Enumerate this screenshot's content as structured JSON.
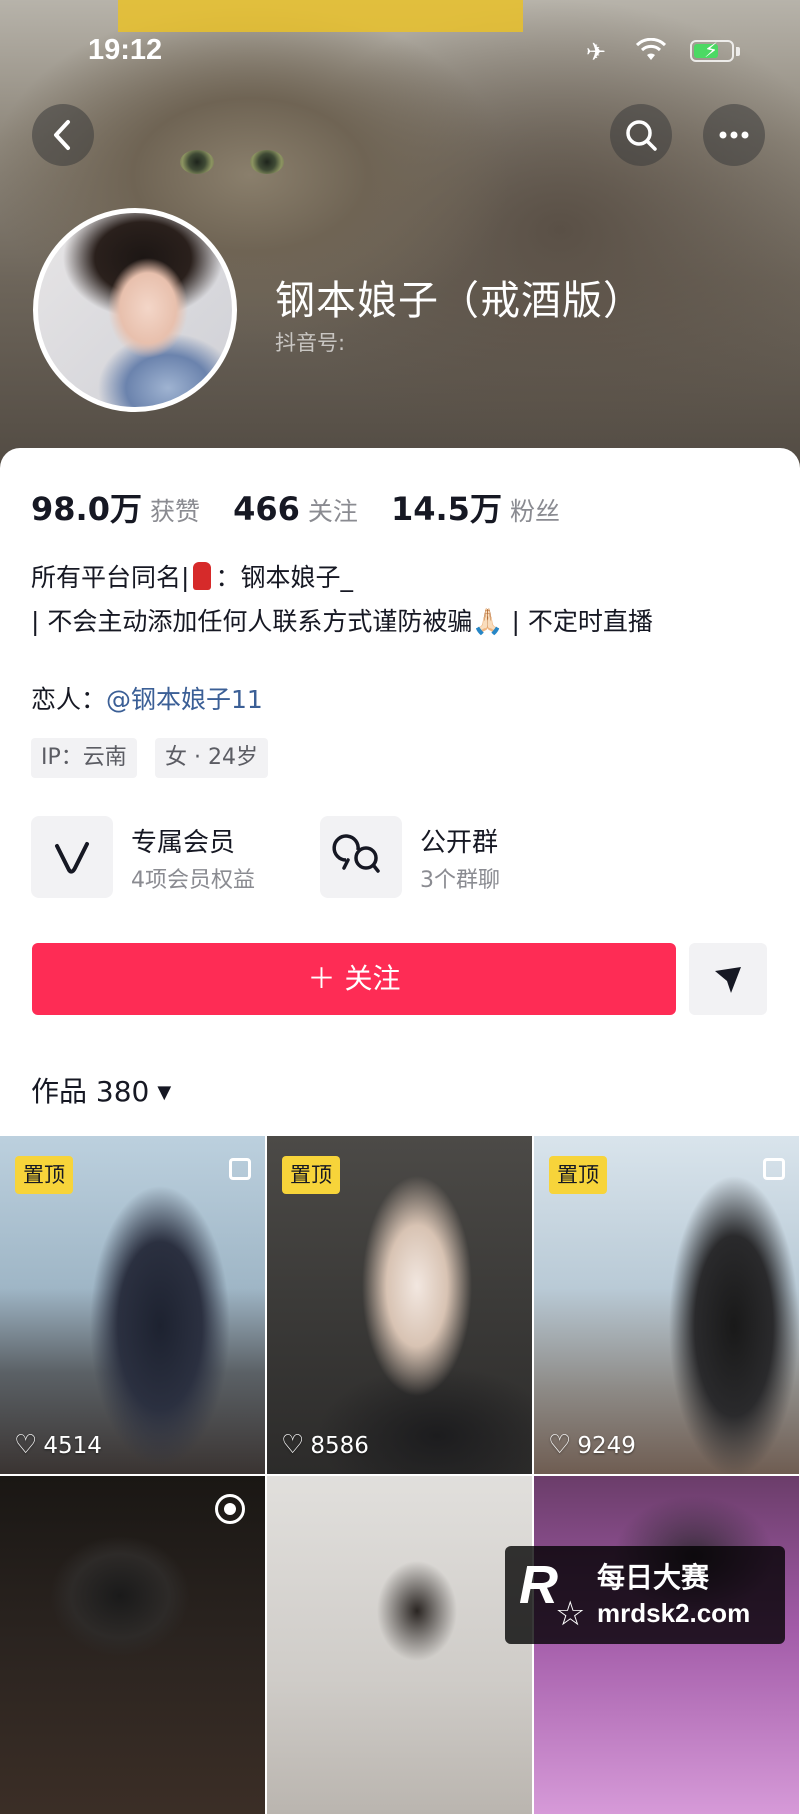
{
  "status_bar": {
    "time": "19:12"
  },
  "profile": {
    "nickname": "钢本娘子（戒酒版）",
    "douyin_id_label": "抖音号:",
    "stats": [
      {
        "num": "98.0万",
        "label": "获赞"
      },
      {
        "num": "466",
        "label": "关注"
      },
      {
        "num": "14.5万",
        "label": "粉丝"
      }
    ],
    "bio_line1_a": "所有平台同名|",
    "bio_line1_b": "：钢本娘子_",
    "bio_line2": "| 不会主动添加任何人联系方式谨防被骗🙏🏻 | 不定时直播",
    "lover_label": "恋人：",
    "lover_mention": "@钢本娘子11",
    "tags": [
      "IP：云南",
      "女 · 24岁"
    ]
  },
  "features": [
    {
      "title": "专属会员",
      "subtitle": "4项会员权益",
      "icon": "v-member-icon"
    },
    {
      "title": "公开群",
      "subtitle": "3个群聊",
      "icon": "group-chat-icon"
    }
  ],
  "actions": {
    "follow_label": "＋ 关注",
    "share_icon": "send-icon"
  },
  "works": {
    "header_label": "作品 380",
    "items": [
      {
        "pinned_label": "置顶",
        "likes": "4514"
      },
      {
        "pinned_label": "置顶",
        "likes": "8586"
      },
      {
        "pinned_label": "置顶",
        "likes": "9249"
      }
    ]
  },
  "watermark": {
    "title": "每日大赛",
    "url": "mrdsk2.com"
  },
  "colors": {
    "accent": "#fe2c55",
    "pin_badge": "#f7d43a",
    "mention": "#3b5f96"
  }
}
